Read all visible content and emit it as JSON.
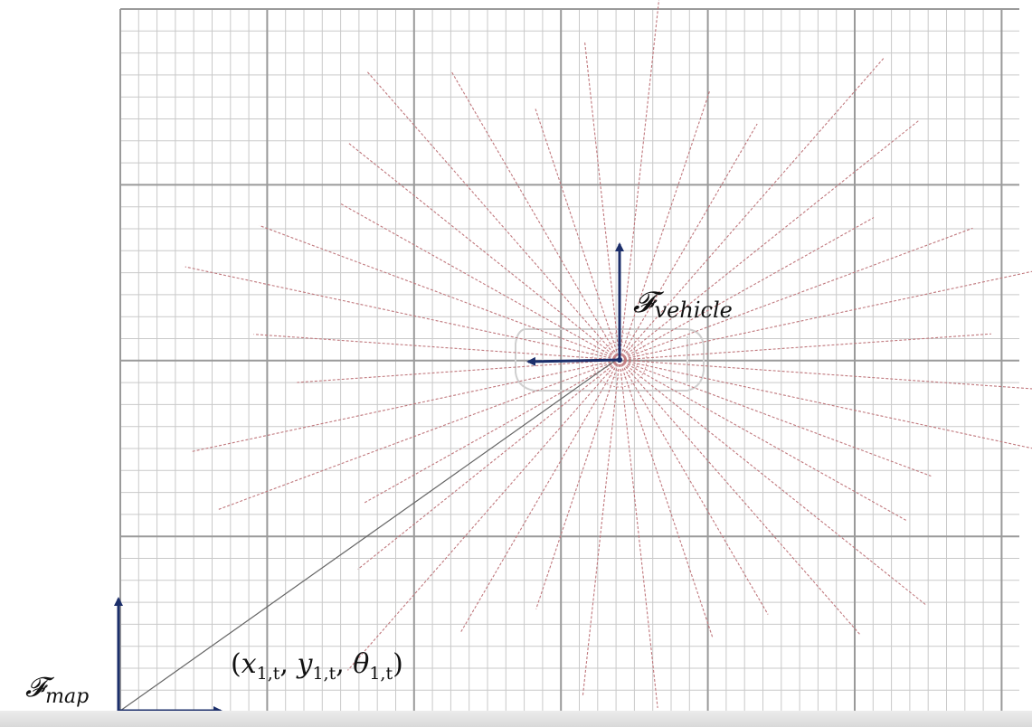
{
  "labels": {
    "vehicle_frame": {
      "symbol": "𝓕",
      "subscript": "vehicle"
    },
    "map_frame": {
      "symbol": "𝓕",
      "subscript": "map"
    },
    "pose": {
      "open": "(",
      "x": "x",
      "x_sub": "1,t",
      "sep1": ", ",
      "y": "y",
      "y_sub": "1,t",
      "sep2": ", ",
      "theta": "θ",
      "theta_sub": "1,t",
      "close": ")"
    }
  },
  "colors": {
    "fine_grid": "#c9c9c9",
    "coarse_grid": "#9a9a9a",
    "ray": "#c0787d",
    "frame_arrow": "#1c2f6b",
    "pose_line": "#666666"
  },
  "grid": {
    "fine_cells_per_coarse": 8
  },
  "rays": {
    "count": 36,
    "start_angle_deg": 5
  }
}
